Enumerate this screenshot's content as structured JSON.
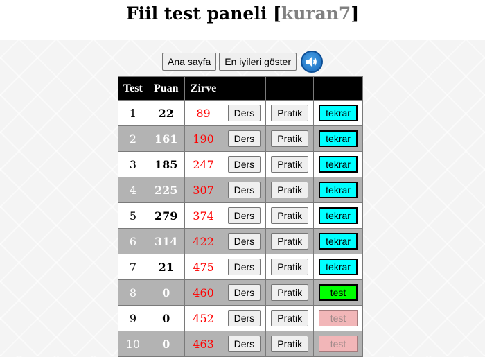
{
  "header": {
    "title": "Fiil test paneli",
    "bracket_open": "[",
    "user": "kuran7",
    "bracket_close": "]"
  },
  "toolbar": {
    "home_label": "Ana sayfa",
    "best_label": "En iyileri göster",
    "sound_icon": "speaker-icon"
  },
  "table": {
    "columns": [
      "Test",
      "Puan",
      "Zirve",
      "",
      "",
      ""
    ],
    "rows": [
      {
        "test": "1",
        "puan": "22",
        "zirve": "89",
        "ders": "Ders",
        "pratik": "Pratik",
        "action": "tekrar",
        "action_state": "tekrar"
      },
      {
        "test": "2",
        "puan": "161",
        "zirve": "190",
        "ders": "Ders",
        "pratik": "Pratik",
        "action": "tekrar",
        "action_state": "tekrar"
      },
      {
        "test": "3",
        "puan": "185",
        "zirve": "247",
        "ders": "Ders",
        "pratik": "Pratik",
        "action": "tekrar",
        "action_state": "tekrar"
      },
      {
        "test": "4",
        "puan": "225",
        "zirve": "307",
        "ders": "Ders",
        "pratik": "Pratik",
        "action": "tekrar",
        "action_state": "tekrar"
      },
      {
        "test": "5",
        "puan": "279",
        "zirve": "374",
        "ders": "Ders",
        "pratik": "Pratik",
        "action": "tekrar",
        "action_state": "tekrar"
      },
      {
        "test": "6",
        "puan": "314",
        "zirve": "422",
        "ders": "Ders",
        "pratik": "Pratik",
        "action": "tekrar",
        "action_state": "tekrar"
      },
      {
        "test": "7",
        "puan": "21",
        "zirve": "475",
        "ders": "Ders",
        "pratik": "Pratik",
        "action": "tekrar",
        "action_state": "tekrar"
      },
      {
        "test": "8",
        "puan": "0",
        "zirve": "460",
        "ders": "Ders",
        "pratik": "Pratik",
        "action": "test",
        "action_state": "test-on"
      },
      {
        "test": "9",
        "puan": "0",
        "zirve": "452",
        "ders": "Ders",
        "pratik": "Pratik",
        "action": "test",
        "action_state": "test-off"
      },
      {
        "test": "10",
        "puan": "0",
        "zirve": "463",
        "ders": "Ders",
        "pratik": "Pratik",
        "action": "test",
        "action_state": "test-off"
      }
    ]
  },
  "colors": {
    "zirve": "#ff0000",
    "tekrar_bg": "#00ffff",
    "test_active_bg": "#00ff00",
    "test_disabled_bg": "#f2b6b8",
    "header_row_bg": "#000000",
    "even_row_bg": "#b3b3b3"
  }
}
